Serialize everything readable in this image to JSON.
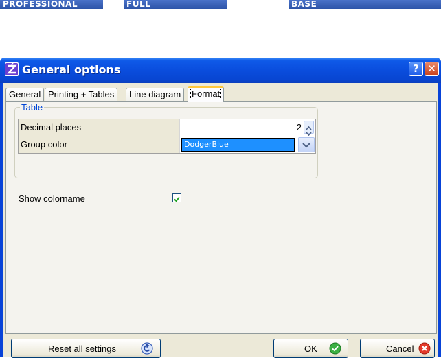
{
  "editions": [
    {
      "label": "PROFESSIONAL"
    },
    {
      "label": "FULL"
    },
    {
      "label": "BASE"
    }
  ],
  "window": {
    "title": "General options",
    "help_label": "?",
    "close_label": "✕"
  },
  "tabs": [
    {
      "label": "General"
    },
    {
      "label": "Printing + Tables"
    },
    {
      "label": "Line diagram"
    },
    {
      "label": "Format"
    }
  ],
  "active_tab": "Format",
  "format": {
    "table_group_label": "Table",
    "rows": [
      {
        "label": "Decimal places",
        "value": "2"
      },
      {
        "label": "Group color",
        "value": "DodgerBlue"
      }
    ],
    "group_color_hex": "#1E90FF",
    "show_colorname_label": "Show colorname",
    "show_colorname_checked": true
  },
  "buttons": {
    "reset_label": "Reset all settings",
    "ok_label": "OK",
    "cancel_label": "Cancel"
  },
  "icons": {
    "app": "app-logo-icon",
    "reset": "undo-arrow-icon",
    "ok": "check-circle-icon",
    "cancel": "x-circle-icon"
  },
  "colors": {
    "titlebar": "#0A4DDD",
    "client_bg": "#ECE9D8",
    "legend_text": "#0046D5"
  }
}
